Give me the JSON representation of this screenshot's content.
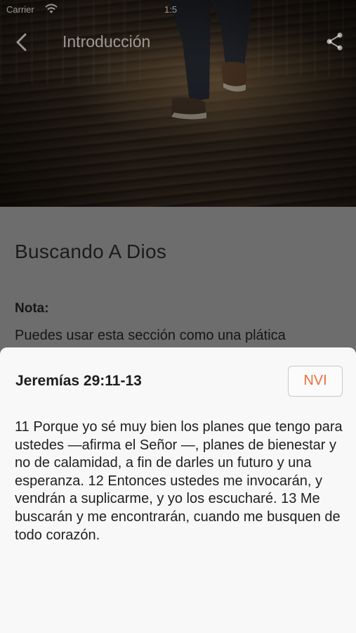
{
  "status_bar": {
    "carrier": "Carrier",
    "time": "1:5"
  },
  "nav": {
    "title": "Introducción",
    "back_icon": "chevron-left-icon",
    "share_icon": "share-icon"
  },
  "content": {
    "heading": "Buscando A Dios",
    "note_label": "Nota:",
    "note_text": "Puedes usar esta sección como una plática"
  },
  "verse_sheet": {
    "reference": "Jeremías 29:11-13",
    "version": "NVI",
    "text": "11 Porque yo sé muy bien los planes que tengo para ustedes —afirma el Señor —, planes de bienestar y no de calamidad, a fin de darles un futuro y una esperanza. 12 Entonces ustedes me invocarán, y vendrán a suplicarme, y yo los escucharé. 13 Me buscarán y me encontrarán, cuando me busquen de todo corazón."
  },
  "colors": {
    "accent": "#e8713a",
    "sheet_bg": "#f8f8f8",
    "overlay": "#6d6d6d"
  }
}
